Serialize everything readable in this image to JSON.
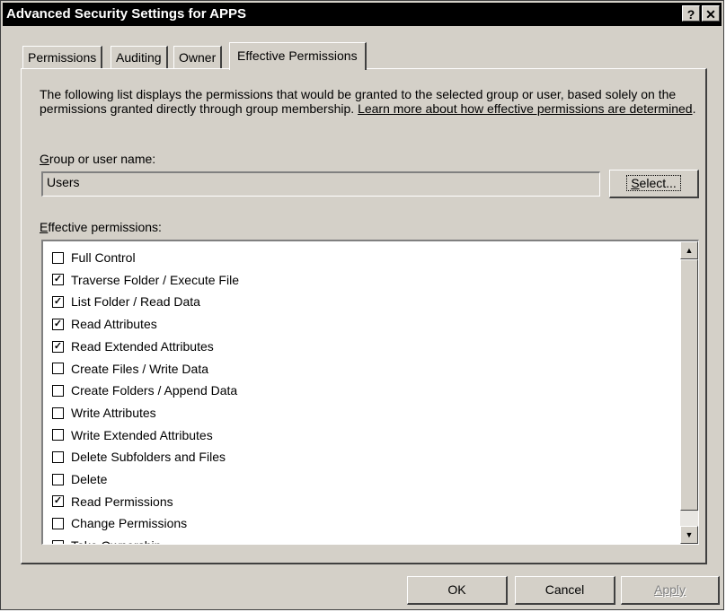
{
  "window": {
    "title": "Advanced Security Settings for APPS",
    "help_label": "?",
    "close_label": "✕"
  },
  "tabs": [
    {
      "label": "Permissions"
    },
    {
      "label": "Auditing"
    },
    {
      "label": "Owner"
    },
    {
      "label": "Effective Permissions",
      "active": true
    }
  ],
  "description": {
    "text": "The following list displays the permissions that would be granted to the selected group or user, based solely on the permissions granted directly through group membership. ",
    "link": "Learn more about how effective permissions are determined",
    "suffix": "."
  },
  "group": {
    "label_access_key": "G",
    "label_rest": "roup or user name:",
    "value": "Users",
    "select_access_key": "S",
    "select_rest": "elect..."
  },
  "effective": {
    "label_access_key": "E",
    "label_rest": "ffective permissions:",
    "items": [
      {
        "label": "Full Control",
        "checked": false
      },
      {
        "label": "Traverse Folder / Execute File",
        "checked": true
      },
      {
        "label": "List Folder / Read Data",
        "checked": true
      },
      {
        "label": "Read Attributes",
        "checked": true
      },
      {
        "label": "Read Extended Attributes",
        "checked": true
      },
      {
        "label": "Create Files / Write Data",
        "checked": false
      },
      {
        "label": "Create Folders / Append Data",
        "checked": false
      },
      {
        "label": "Write Attributes",
        "checked": false
      },
      {
        "label": "Write Extended Attributes",
        "checked": false
      },
      {
        "label": "Delete Subfolders and Files",
        "checked": false
      },
      {
        "label": "Delete",
        "checked": false
      },
      {
        "label": "Read Permissions",
        "checked": true
      },
      {
        "label": "Change Permissions",
        "checked": false
      },
      {
        "label": "Take Ownership",
        "checked": false
      }
    ]
  },
  "footer": {
    "ok": "OK",
    "cancel": "Cancel",
    "apply": "Apply",
    "apply_enabled": false
  }
}
